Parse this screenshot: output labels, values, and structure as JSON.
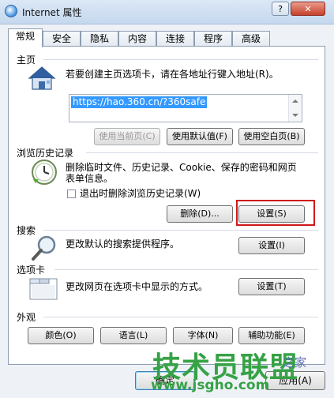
{
  "window": {
    "title": "Internet 属性",
    "help_label": "?",
    "close_label": "✕"
  },
  "tabs": [
    "常规",
    "安全",
    "隐私",
    "内容",
    "连接",
    "程序",
    "高级"
  ],
  "home": {
    "section_label": "主页",
    "description": "若要创建主页选项卡，请在各地址行键入地址(R)。",
    "url": "https://hao.360.cn/?360safe",
    "buttons": {
      "use_current": "使用当前页(C)",
      "use_default": "使用默认值(F)",
      "use_blank": "使用空白页(B)"
    }
  },
  "history": {
    "section_label": "浏览历史记录",
    "description_line1": "删除临时文件、历史记录、Cookie、保存的密码和网页",
    "description_line2": "表单信息。",
    "checkbox_label": "退出时删除浏览历史记录(W)",
    "delete_button": "删除(D)...",
    "settings_button": "设置(S)"
  },
  "search": {
    "section_label": "搜索",
    "description": "更改默认的搜索提供程序。",
    "settings_button": "设置(I)"
  },
  "tabs_section": {
    "section_label": "选项卡",
    "description": "更改网页在选项卡中显示的方式。",
    "settings_button": "设置(T)"
  },
  "appearance": {
    "section_label": "外观",
    "buttons": {
      "colors": "颜色(O)",
      "languages": "语言(L)",
      "fonts": "字体(N)",
      "accessibility": "辅助功能(E)"
    }
  },
  "dialog_buttons": {
    "ok": "确定",
    "apply": "应用(A)"
  },
  "watermark": {
    "title": "技术员联盟",
    "url": "www.jsgho.com",
    "side": "之家"
  },
  "colors": {
    "accent_highlight": "#d01818",
    "selection": "#3399ff",
    "watermark": "#36a245"
  },
  "icons": [
    "internet-options-icon",
    "home-house-icon",
    "history-clock-icon",
    "search-magnifier-icon",
    "tabs-window-icon"
  ]
}
